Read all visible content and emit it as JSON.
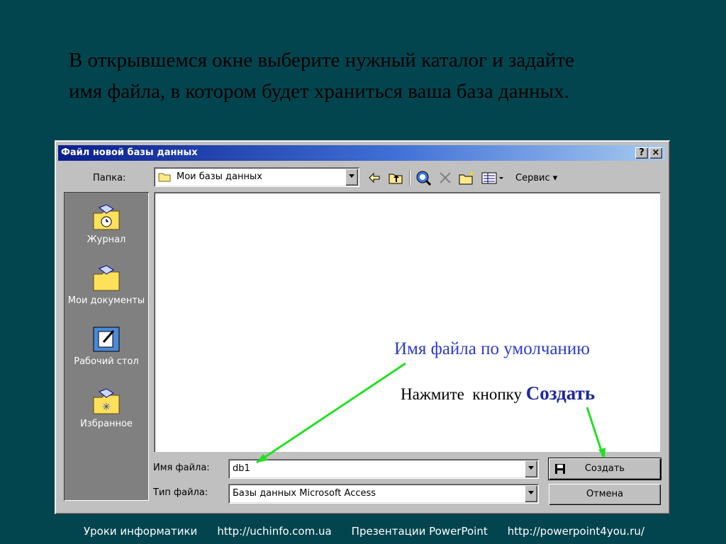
{
  "slide": {
    "instruction_line1": "В открывшемся окне выберите нужный каталог и задайте",
    "instruction_line2": "имя файла, в котором будет храниться ваша база данных."
  },
  "dialog": {
    "title": "Файл новой базы данных",
    "help_btn": "?",
    "close_btn": "×",
    "folder_label": "Папка:",
    "folder_value": "Мои базы данных",
    "tools_label": "Сервис",
    "places": [
      {
        "label": "Журнал",
        "icon": "history-folder-icon"
      },
      {
        "label": "Мои документы",
        "icon": "my-documents-folder-icon"
      },
      {
        "label": "Рабочий стол",
        "icon": "desktop-icon"
      },
      {
        "label": "Избранное",
        "icon": "favorites-folder-icon"
      }
    ],
    "filename_label": "Имя файла:",
    "filename_value": "db1",
    "filetype_label": "Тип файла:",
    "filetype_value": "Базы данных Microsoft Access",
    "create_btn": "Создать",
    "cancel_btn": "Отмена"
  },
  "annotations": {
    "default_name": "Имя файла по умолчанию",
    "press_prefix": "Нажмите  кнопку ",
    "press_button": "Создать",
    "arrow_color": "#22e022",
    "text_blue": "#2b3bc8"
  },
  "footer": {
    "left_text": "Уроки информатики",
    "left_url": "http://uchinfo.com.ua",
    "right_text": "Презентации PowerPoint",
    "right_url": "http://powerpoint4you.ru/"
  }
}
